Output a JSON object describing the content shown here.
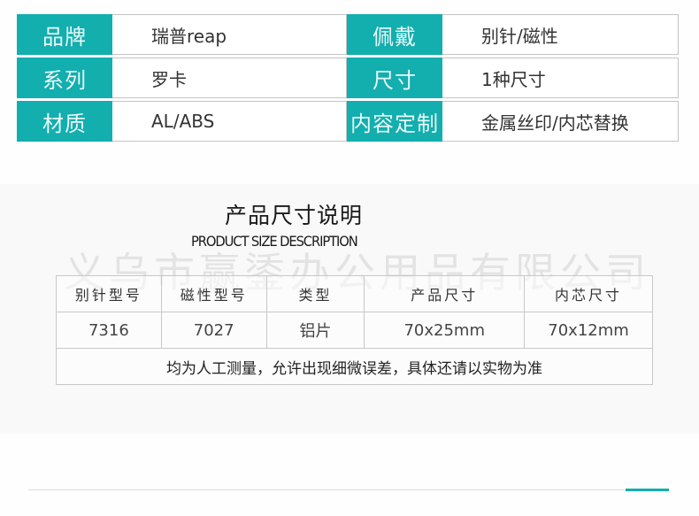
{
  "colors": {
    "accent": "#13aeae",
    "border": "#c4c4c4"
  },
  "specs": [
    {
      "label": "品牌",
      "value": "瑞普reap",
      "label2": "佩戴",
      "value2": "别针/磁性"
    },
    {
      "label": "系列",
      "value": "罗卡",
      "label2": "尺寸",
      "value2": "1种尺寸"
    },
    {
      "label": "材质",
      "value": "AL/ABS",
      "label2": "内容定制",
      "value2": "金属丝印/内芯替换"
    }
  ],
  "size_section": {
    "title_cn": "产品尺寸说明",
    "title_en": "PRODUCT SIZE DESCRIPTION",
    "watermark": "义乌市赢鋈办公用品有限公司",
    "headers": [
      "别针型号",
      "磁性型号",
      "类型",
      "产品尺寸",
      "内芯尺寸"
    ],
    "row": [
      "7316",
      "7027",
      "铝片",
      "70x25mm",
      "70x12mm"
    ],
    "note": "均为人工测量，允许出现细微误差，具体还请以实物为准"
  }
}
